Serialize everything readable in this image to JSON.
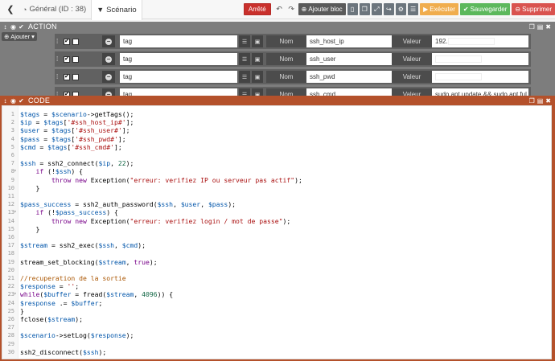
{
  "tabs": [
    {
      "label": "Général (ID : 38)",
      "icon": "tachometer-icon"
    },
    {
      "label": "Scénario",
      "icon": "filter-icon"
    }
  ],
  "toolbar": {
    "stop_label": "Arrêté",
    "add_block_label": "Ajouter bloc",
    "execute_label": "Exécuter",
    "save_label": "Sauvegarder",
    "delete_label": "Supprimer"
  },
  "action_block": {
    "title": "ACTION",
    "add_label": "Ajouter",
    "rows": [
      {
        "cmd": "tag",
        "nom_label": "Nom",
        "name": "ssh_host_ip",
        "valeur_label": "Valeur",
        "value": "192."
      },
      {
        "cmd": "tag",
        "nom_label": "Nom",
        "name": "ssh_user",
        "valeur_label": "Valeur",
        "value": ""
      },
      {
        "cmd": "tag",
        "nom_label": "Nom",
        "name": "ssh_pwd",
        "valeur_label": "Valeur",
        "value": ""
      },
      {
        "cmd": "tag",
        "nom_label": "Nom",
        "name": "ssh_cmd",
        "valeur_label": "Valeur",
        "value": "sudo apt update && sudo apt ful"
      }
    ]
  },
  "code_block": {
    "title": "CODE",
    "lines": [
      {
        "n": "1",
        "fold": "",
        "html": "<span class=\"v\">$tags</span> = <span class=\"v\">$scenario</span>-&gt;getTags();"
      },
      {
        "n": "2",
        "fold": "",
        "html": "<span class=\"v\">$ip</span> = <span class=\"v\">$tags</span>[<span class=\"s\">'#ssh_host_ip#'</span>];"
      },
      {
        "n": "3",
        "fold": "",
        "html": "<span class=\"v\">$user</span> = <span class=\"v\">$tags</span>[<span class=\"s\">'#ssh_user#'</span>];"
      },
      {
        "n": "4",
        "fold": "",
        "html": "<span class=\"v\">$pass</span> = <span class=\"v\">$tags</span>[<span class=\"s\">'#ssh_pwd#'</span>];"
      },
      {
        "n": "5",
        "fold": "",
        "html": "<span class=\"v\">$cmd</span> = <span class=\"v\">$tags</span>[<span class=\"s\">'#ssh_cmd#'</span>];"
      },
      {
        "n": "6",
        "fold": "",
        "html": ""
      },
      {
        "n": "7",
        "fold": "",
        "html": "<span class=\"v\">$ssh</span> = ssh2_connect(<span class=\"v\">$ip</span>, <span class=\"n\">22</span>);"
      },
      {
        "n": "8",
        "fold": "▾",
        "html": "    <span class=\"k\">if</span> (!<span class=\"v\">$ssh</span>) {"
      },
      {
        "n": "9",
        "fold": "",
        "html": "        <span class=\"k\">throw</span> <span class=\"k\">new</span> Exception(<span class=\"s\">\"erreur: verifiez IP ou serveur pas actif\"</span>);"
      },
      {
        "n": "10",
        "fold": "",
        "html": "    }"
      },
      {
        "n": "11",
        "fold": "",
        "html": ""
      },
      {
        "n": "12",
        "fold": "",
        "html": "<span class=\"v\">$pass_success</span> = ssh2_auth_password(<span class=\"v\">$ssh</span>, <span class=\"v\">$user</span>, <span class=\"v\">$pass</span>);"
      },
      {
        "n": "13",
        "fold": "▾",
        "html": "    <span class=\"k\">if</span> (!<span class=\"v\">$pass_success</span>) {"
      },
      {
        "n": "14",
        "fold": "",
        "html": "        <span class=\"k\">throw</span> <span class=\"k\">new</span> Exception(<span class=\"s\">\"erreur: verifiez login / mot de passe\"</span>);"
      },
      {
        "n": "15",
        "fold": "",
        "html": "    }"
      },
      {
        "n": "16",
        "fold": "",
        "html": ""
      },
      {
        "n": "17",
        "fold": "",
        "html": "<span class=\"v\">$stream</span> = ssh2_exec(<span class=\"v\">$ssh</span>, <span class=\"v\">$cmd</span>);"
      },
      {
        "n": "18",
        "fold": "",
        "html": ""
      },
      {
        "n": "19",
        "fold": "",
        "html": "stream_set_blocking(<span class=\"v\">$stream</span>, <span class=\"k\">true</span>);"
      },
      {
        "n": "20",
        "fold": "",
        "html": ""
      },
      {
        "n": "21",
        "fold": "",
        "html": "<span class=\"c\">//recuperation de la sortie</span>"
      },
      {
        "n": "22",
        "fold": "",
        "html": "<span class=\"v\">$response</span> = <span class=\"s\">''</span>;"
      },
      {
        "n": "23",
        "fold": "▾",
        "html": "<span class=\"k\">while</span>(<span class=\"v\">$buffer</span> = fread(<span class=\"v\">$stream</span>, <span class=\"n\">4096</span>)) {"
      },
      {
        "n": "24",
        "fold": "",
        "html": "<span class=\"v\">$response</span> .= <span class=\"v\">$buffer</span>;"
      },
      {
        "n": "25",
        "fold": "",
        "html": "}"
      },
      {
        "n": "26",
        "fold": "",
        "html": "fclose(<span class=\"v\">$stream</span>);"
      },
      {
        "n": "27",
        "fold": "",
        "html": ""
      },
      {
        "n": "28",
        "fold": "",
        "html": "<span class=\"v\">$scenario</span>-&gt;setLog(<span class=\"v\">$response</span>);"
      },
      {
        "n": "29",
        "fold": "",
        "html": ""
      },
      {
        "n": "30",
        "fold": "",
        "html": "ssh2_disconnect(<span class=\"v\">$ssh</span>);"
      }
    ]
  }
}
